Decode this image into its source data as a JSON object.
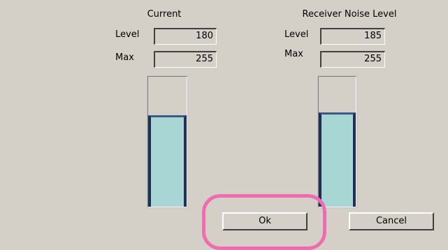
{
  "current": {
    "title": "Current",
    "level_label": "Level",
    "level_value": "180",
    "max_label": "Max",
    "max_value": "255",
    "fill_fraction": 0.706
  },
  "noise": {
    "title": "Receiver Noise Level",
    "level_label": "Level",
    "level_value": "185",
    "max_label": "Max",
    "max_value": "255",
    "fill_fraction": 0.725
  },
  "buttons": {
    "ok": "Ok",
    "cancel": "Cancel"
  },
  "colors": {
    "background": "#d4d0c8",
    "bar_fill": "#a7d6d4",
    "bar_edge": "#1f2f55",
    "highlight": "#f06cb0"
  }
}
